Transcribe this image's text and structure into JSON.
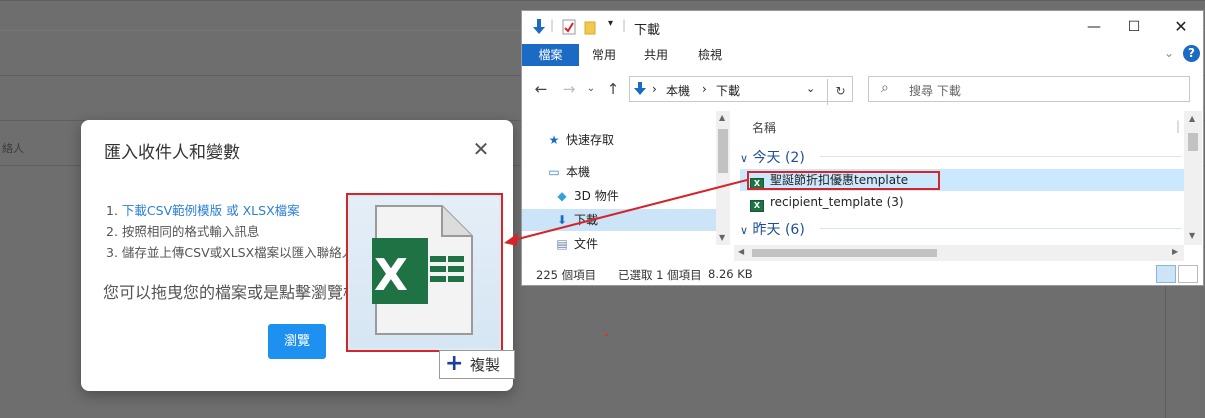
{
  "background": {
    "partial_label": "絡人"
  },
  "dialog": {
    "title": "匯入收件人和變數",
    "close_icon": "close-icon",
    "steps": [
      {
        "num": "1.",
        "link1": "下載CSV範例模版",
        "sep": " 或",
        "link2": "XLSX檔案"
      },
      {
        "num": "2.",
        "text": "按照相同的格式輸入訊息"
      },
      {
        "num": "3.",
        "text": "儲存並上傳CSV或XLSX檔案以匯入聯絡人"
      }
    ],
    "drop_hint": "您可以拖曳您的檔案或是點擊瀏覽檔案列表",
    "browse_button": "瀏覽"
  },
  "drag_ghost": {
    "icon": "excel-file-icon",
    "copy_label": "複製"
  },
  "explorer": {
    "quick_access_toolbar": [
      "download-arrow-icon",
      "properties-icon",
      "new-folder-icon"
    ],
    "title": "下載",
    "window_controls": [
      "minimize",
      "maximize",
      "close"
    ],
    "ribbon_tabs": [
      "檔案",
      "常用",
      "共用",
      "檢視"
    ],
    "breadcrumb": [
      "本機",
      "下載"
    ],
    "search_placeholder": "搜尋 下載",
    "nav_items": [
      {
        "label": "快速存取",
        "icon": "star-icon"
      },
      {
        "label": "本機",
        "icon": "computer-icon"
      },
      {
        "label": "3D 物件",
        "icon": "cube-icon"
      },
      {
        "label": "下載",
        "icon": "download-icon",
        "selected": true
      },
      {
        "label": "文件",
        "icon": "document-icon"
      }
    ],
    "column_header": "名稱",
    "groups": [
      {
        "label": "今天 (2)",
        "files": [
          {
            "name": "聖誕節折扣優惠template",
            "selected": true
          },
          {
            "name": "recipient_template (3)",
            "selected": false
          }
        ]
      },
      {
        "label": "昨天 (6)",
        "files": []
      }
    ],
    "status": {
      "item_count": "225 個項目",
      "selection": "已選取 1 個項目",
      "size": "8.26 KB"
    },
    "colors": {
      "accent": "#1b6ac4",
      "selection": "#cce8ff",
      "highlight_box": "#d4252b"
    }
  }
}
